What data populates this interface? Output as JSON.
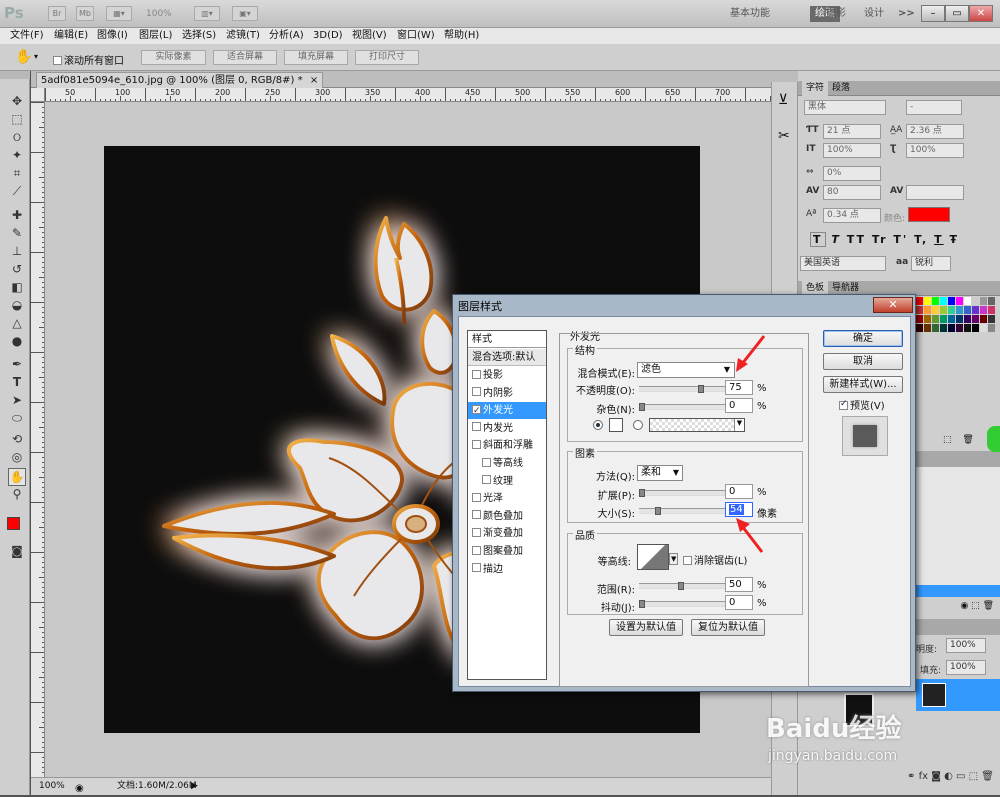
{
  "app": {
    "logo": "Ps",
    "zoom": "100%",
    "workspaces": [
      "基本功能",
      "绘画",
      "摄影",
      "设计"
    ],
    "active_workspace": "绘画",
    "more": ">>"
  },
  "menu": [
    "文件(F)",
    "编辑(E)",
    "图像(I)",
    "图层(L)",
    "选择(S)",
    "滤镜(T)",
    "分析(A)",
    "3D(D)",
    "视图(V)",
    "窗口(W)",
    "帮助(H)"
  ],
  "options": {
    "scroll_all": "滚动所有窗口",
    "buttons": [
      "实际像素",
      "适合屏幕",
      "填充屏幕",
      "打印尺寸"
    ]
  },
  "document": {
    "tab": "5adf081e5094e_610.jpg @ 100% (图层 0, RGB/8#) *",
    "close": "×",
    "ruler_top": [
      "50",
      "100",
      "150",
      "200",
      "250",
      "300",
      "350",
      "400",
      "450",
      "500",
      "550",
      "600",
      "650",
      "700"
    ],
    "status_zoom": "100%",
    "status_doc": "文档:1.60M/2.06M"
  },
  "char_panel": {
    "tabs": [
      "字符",
      "段落"
    ],
    "font_family": "黑体",
    "font_style": "-",
    "font_size": "21 点",
    "leading": "2.36 点",
    "vscale": "100%",
    "hscale": "100%",
    "tracking_pct": "0%",
    "kerning": "80",
    "baseline": "0.34 点",
    "color_label": "颜色:",
    "color": "#ff0000",
    "styles": [
      "T",
      "T",
      "TT",
      "Tr",
      "T'",
      "T,",
      "T",
      "Ŧ"
    ],
    "language": "美国英语",
    "aa_label": "aa",
    "aa_value": "锐利"
  },
  "swatch_panel": {
    "tabs": [
      "色板",
      "导航器"
    ]
  },
  "layers_panel": {
    "opacity_label": "明度:",
    "opacity": "100%",
    "fill_label": "填充:",
    "fill": "100%"
  },
  "dialog": {
    "title": "图层样式",
    "close": "✕",
    "styles_header": "样式",
    "blend_options": "混合选项:默认",
    "style_items": [
      {
        "label": "投影",
        "checked": false,
        "indent": false
      },
      {
        "label": "内阴影",
        "checked": false,
        "indent": false
      },
      {
        "label": "外发光",
        "checked": true,
        "indent": false,
        "selected": true
      },
      {
        "label": "内发光",
        "checked": false,
        "indent": false
      },
      {
        "label": "斜面和浮雕",
        "checked": false,
        "indent": false
      },
      {
        "label": "等高线",
        "checked": false,
        "indent": true
      },
      {
        "label": "纹理",
        "checked": false,
        "indent": true
      },
      {
        "label": "光泽",
        "checked": false,
        "indent": false
      },
      {
        "label": "颜色叠加",
        "checked": false,
        "indent": false
      },
      {
        "label": "渐变叠加",
        "checked": false,
        "indent": false
      },
      {
        "label": "图案叠加",
        "checked": false,
        "indent": false
      },
      {
        "label": "描边",
        "checked": false,
        "indent": false
      }
    ],
    "section_title": "外发光",
    "structure": {
      "label": "结构",
      "blend_mode_label": "混合模式(E):",
      "blend_mode": "滤色",
      "opacity_label": "不透明度(O):",
      "opacity": "75",
      "opacity_unit": "%",
      "opacity_level": 0.75,
      "noise_label": "杂色(N):",
      "noise": "0",
      "noise_unit": "%",
      "noise_level": 0
    },
    "elements": {
      "label": "图素",
      "method_label": "方法(Q):",
      "method": "柔和",
      "spread_label": "扩展(P):",
      "spread": "0",
      "spread_unit": "%",
      "spread_level": 0,
      "size_label": "大小(S):",
      "size": "54",
      "size_unit": "像素",
      "size_level": 0.21
    },
    "quality": {
      "label": "品质",
      "contour_label": "等高线:",
      "antialias_label": "消除锯齿(L)",
      "range_label": "范围(R):",
      "range": "50",
      "range_unit": "%",
      "range_level": 0.5,
      "jitter_label": "抖动(J):",
      "jitter": "0",
      "jitter_unit": "%",
      "jitter_level": 0
    },
    "reset_default": "设置为默认值",
    "restore_default": "复位为默认值",
    "ok": "确定",
    "cancel": "取消",
    "new_style": "新建样式(W)...",
    "preview_label": "预览(V)"
  },
  "watermark": {
    "brand": "Baidu经验",
    "url": "jingyan.baidu.com"
  }
}
